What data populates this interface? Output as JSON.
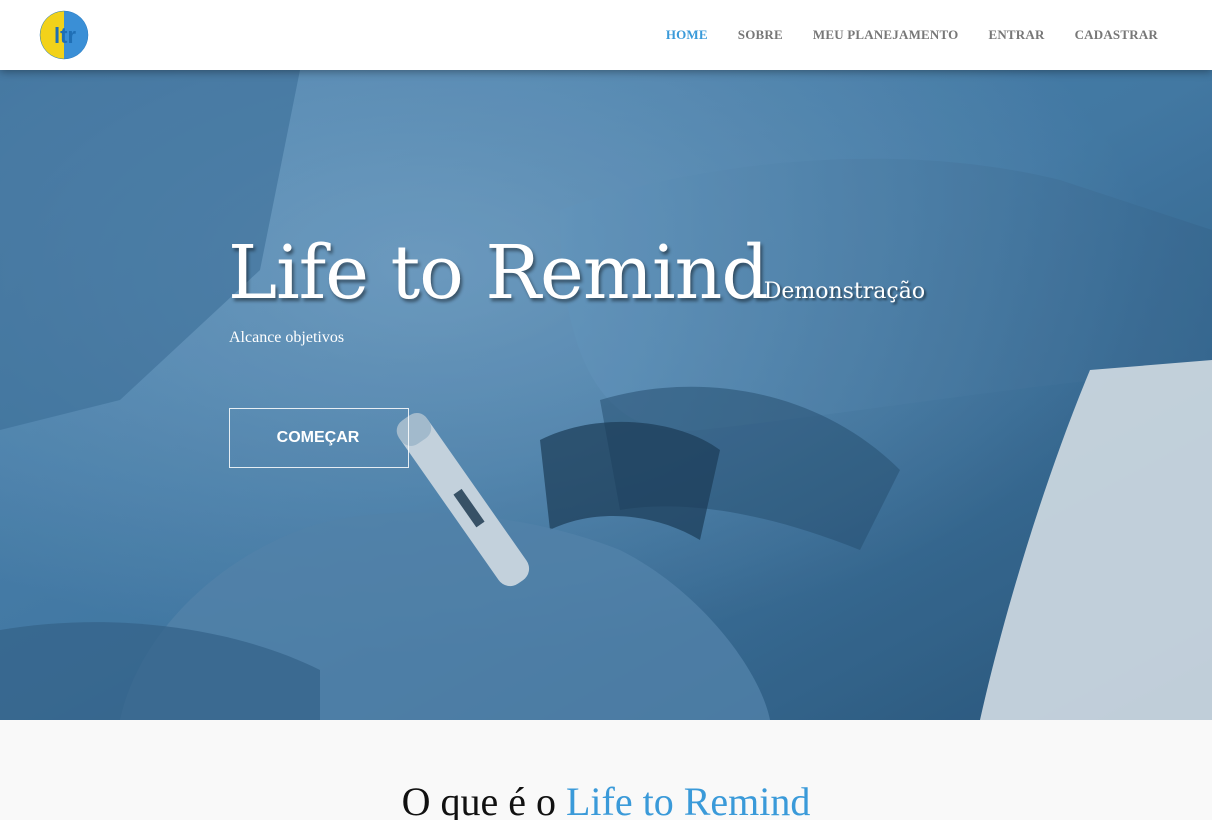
{
  "brand": {
    "logo_text": "ltr",
    "logo_icon": "ltr-logo-icon"
  },
  "nav": {
    "items": [
      {
        "label": "HOME",
        "active": true
      },
      {
        "label": "SOBRE",
        "active": false
      },
      {
        "label": "MEU PLANEJAMENTO",
        "active": false
      },
      {
        "label": "ENTRAR",
        "active": false
      },
      {
        "label": "CADASTRAR",
        "active": false
      }
    ]
  },
  "hero": {
    "title": "Life to Remind",
    "badge": "Demonstração",
    "tagline": "Alcance objetivos",
    "cta_label": "COMEÇAR"
  },
  "section": {
    "title_prefix": "O que é o ",
    "title_accent": "Life to Remind"
  },
  "colors": {
    "accent": "#3a9ad9",
    "nav_text": "#777777",
    "hero_tint": "#3f7aa6"
  }
}
